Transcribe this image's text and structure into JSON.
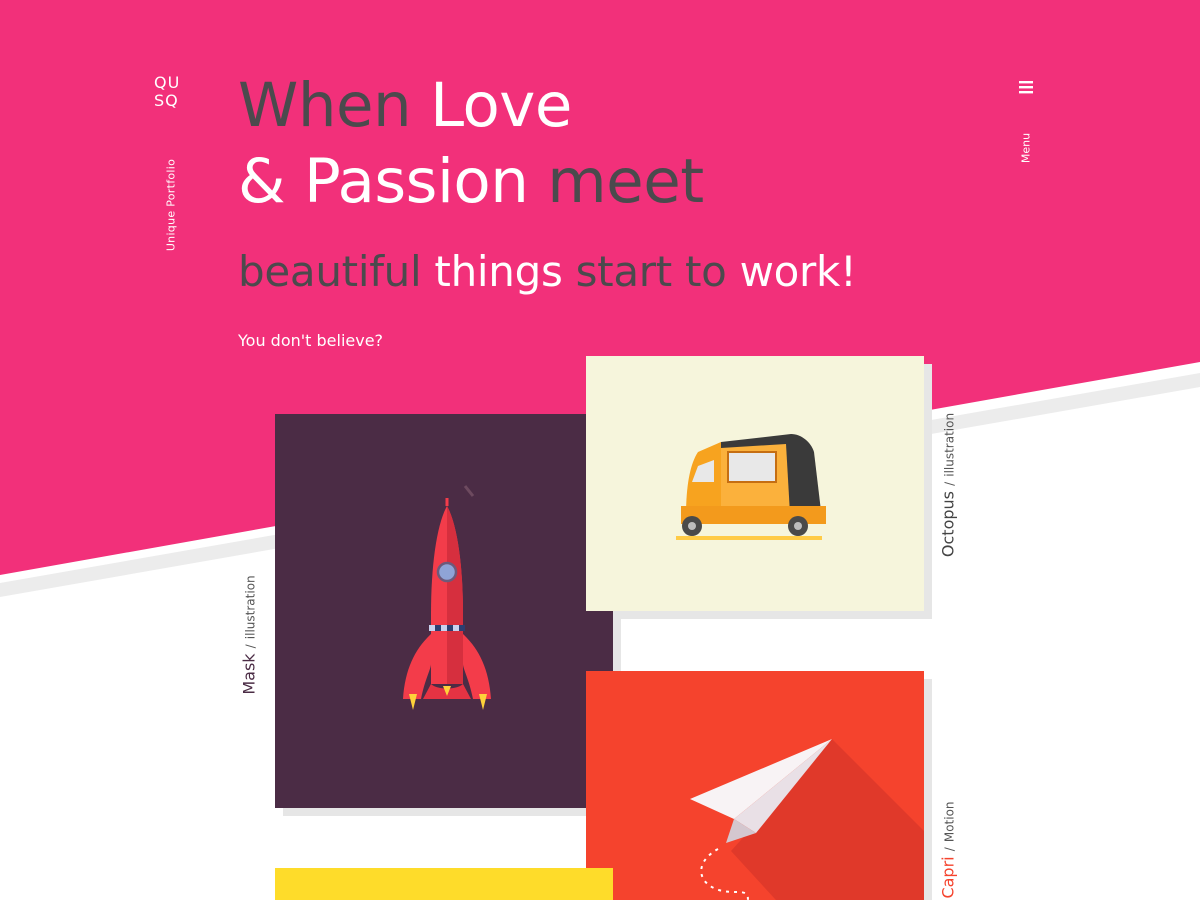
{
  "colors": {
    "brand_pink": "#f2307a",
    "dark_text": "#4b4a4d",
    "rocket_bg": "#4b2c45",
    "rickshaw_bg": "#f6f5dc",
    "plane_bg": "#f5432d",
    "yellow_bg": "#fedc2a"
  },
  "logo": {
    "line1": "QU",
    "line2": "SQ"
  },
  "tagline": "Unique Portfolio",
  "hero": {
    "line1_a": "When ",
    "line1_b": "Love",
    "line2_a": "& Passion",
    "line2_b": " meet",
    "sub_a": "beautiful ",
    "sub_b": "things",
    "sub_c": " start to ",
    "sub_d": "work!",
    "question": "You don't believe?"
  },
  "menu": {
    "label": "Menu",
    "icon": "hamburger-icon"
  },
  "portfolio": [
    {
      "title": "Mask",
      "category": "illustration",
      "icon": "rocket-icon"
    },
    {
      "title": "Octopus",
      "category": "illustration",
      "icon": "auto-rickshaw-icon"
    },
    {
      "title": "Capri",
      "category": "Motion",
      "icon": "paper-plane-icon"
    },
    {
      "title": "",
      "category": "",
      "icon": ""
    }
  ],
  "separator": "/"
}
